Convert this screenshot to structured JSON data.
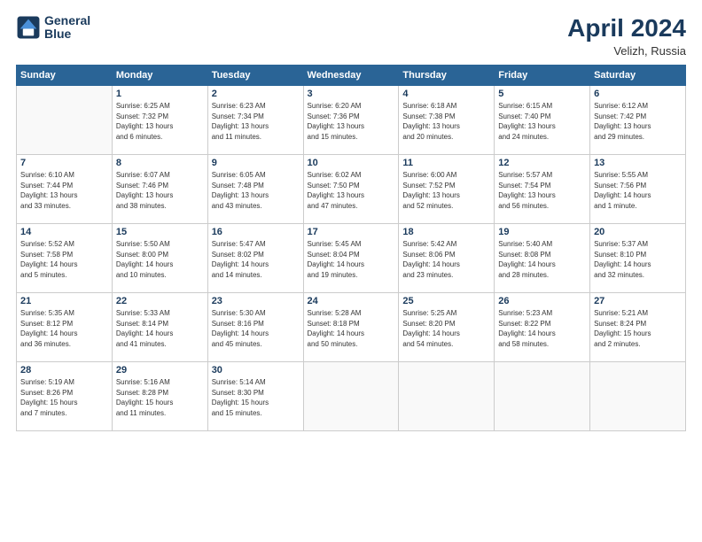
{
  "header": {
    "logo_line1": "General",
    "logo_line2": "Blue",
    "month": "April 2024",
    "location": "Velizh, Russia"
  },
  "weekdays": [
    "Sunday",
    "Monday",
    "Tuesday",
    "Wednesday",
    "Thursday",
    "Friday",
    "Saturday"
  ],
  "weeks": [
    [
      {
        "day": "",
        "info": ""
      },
      {
        "day": "1",
        "info": "Sunrise: 6:25 AM\nSunset: 7:32 PM\nDaylight: 13 hours\nand 6 minutes."
      },
      {
        "day": "2",
        "info": "Sunrise: 6:23 AM\nSunset: 7:34 PM\nDaylight: 13 hours\nand 11 minutes."
      },
      {
        "day": "3",
        "info": "Sunrise: 6:20 AM\nSunset: 7:36 PM\nDaylight: 13 hours\nand 15 minutes."
      },
      {
        "day": "4",
        "info": "Sunrise: 6:18 AM\nSunset: 7:38 PM\nDaylight: 13 hours\nand 20 minutes."
      },
      {
        "day": "5",
        "info": "Sunrise: 6:15 AM\nSunset: 7:40 PM\nDaylight: 13 hours\nand 24 minutes."
      },
      {
        "day": "6",
        "info": "Sunrise: 6:12 AM\nSunset: 7:42 PM\nDaylight: 13 hours\nand 29 minutes."
      }
    ],
    [
      {
        "day": "7",
        "info": "Sunrise: 6:10 AM\nSunset: 7:44 PM\nDaylight: 13 hours\nand 33 minutes."
      },
      {
        "day": "8",
        "info": "Sunrise: 6:07 AM\nSunset: 7:46 PM\nDaylight: 13 hours\nand 38 minutes."
      },
      {
        "day": "9",
        "info": "Sunrise: 6:05 AM\nSunset: 7:48 PM\nDaylight: 13 hours\nand 43 minutes."
      },
      {
        "day": "10",
        "info": "Sunrise: 6:02 AM\nSunset: 7:50 PM\nDaylight: 13 hours\nand 47 minutes."
      },
      {
        "day": "11",
        "info": "Sunrise: 6:00 AM\nSunset: 7:52 PM\nDaylight: 13 hours\nand 52 minutes."
      },
      {
        "day": "12",
        "info": "Sunrise: 5:57 AM\nSunset: 7:54 PM\nDaylight: 13 hours\nand 56 minutes."
      },
      {
        "day": "13",
        "info": "Sunrise: 5:55 AM\nSunset: 7:56 PM\nDaylight: 14 hours\nand 1 minute."
      }
    ],
    [
      {
        "day": "14",
        "info": "Sunrise: 5:52 AM\nSunset: 7:58 PM\nDaylight: 14 hours\nand 5 minutes."
      },
      {
        "day": "15",
        "info": "Sunrise: 5:50 AM\nSunset: 8:00 PM\nDaylight: 14 hours\nand 10 minutes."
      },
      {
        "day": "16",
        "info": "Sunrise: 5:47 AM\nSunset: 8:02 PM\nDaylight: 14 hours\nand 14 minutes."
      },
      {
        "day": "17",
        "info": "Sunrise: 5:45 AM\nSunset: 8:04 PM\nDaylight: 14 hours\nand 19 minutes."
      },
      {
        "day": "18",
        "info": "Sunrise: 5:42 AM\nSunset: 8:06 PM\nDaylight: 14 hours\nand 23 minutes."
      },
      {
        "day": "19",
        "info": "Sunrise: 5:40 AM\nSunset: 8:08 PM\nDaylight: 14 hours\nand 28 minutes."
      },
      {
        "day": "20",
        "info": "Sunrise: 5:37 AM\nSunset: 8:10 PM\nDaylight: 14 hours\nand 32 minutes."
      }
    ],
    [
      {
        "day": "21",
        "info": "Sunrise: 5:35 AM\nSunset: 8:12 PM\nDaylight: 14 hours\nand 36 minutes."
      },
      {
        "day": "22",
        "info": "Sunrise: 5:33 AM\nSunset: 8:14 PM\nDaylight: 14 hours\nand 41 minutes."
      },
      {
        "day": "23",
        "info": "Sunrise: 5:30 AM\nSunset: 8:16 PM\nDaylight: 14 hours\nand 45 minutes."
      },
      {
        "day": "24",
        "info": "Sunrise: 5:28 AM\nSunset: 8:18 PM\nDaylight: 14 hours\nand 50 minutes."
      },
      {
        "day": "25",
        "info": "Sunrise: 5:25 AM\nSunset: 8:20 PM\nDaylight: 14 hours\nand 54 minutes."
      },
      {
        "day": "26",
        "info": "Sunrise: 5:23 AM\nSunset: 8:22 PM\nDaylight: 14 hours\nand 58 minutes."
      },
      {
        "day": "27",
        "info": "Sunrise: 5:21 AM\nSunset: 8:24 PM\nDaylight: 15 hours\nand 2 minutes."
      }
    ],
    [
      {
        "day": "28",
        "info": "Sunrise: 5:19 AM\nSunset: 8:26 PM\nDaylight: 15 hours\nand 7 minutes."
      },
      {
        "day": "29",
        "info": "Sunrise: 5:16 AM\nSunset: 8:28 PM\nDaylight: 15 hours\nand 11 minutes."
      },
      {
        "day": "30",
        "info": "Sunrise: 5:14 AM\nSunset: 8:30 PM\nDaylight: 15 hours\nand 15 minutes."
      },
      {
        "day": "",
        "info": ""
      },
      {
        "day": "",
        "info": ""
      },
      {
        "day": "",
        "info": ""
      },
      {
        "day": "",
        "info": ""
      }
    ]
  ]
}
